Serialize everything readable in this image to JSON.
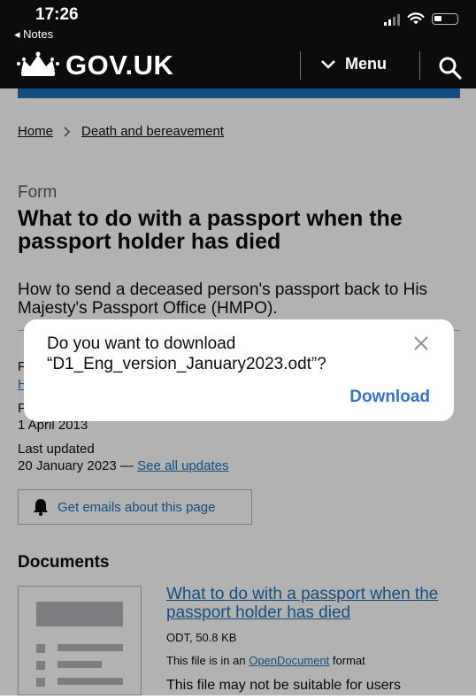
{
  "status_bar": {
    "time": "17:26",
    "back_app": "◂ Notes"
  },
  "header": {
    "logo_text": "GOV.UK",
    "menu_label": "Menu"
  },
  "breadcrumb": {
    "items": [
      "Home",
      "Death and bereavement"
    ]
  },
  "page": {
    "caption": "Form",
    "title": "What to do with a passport when the passport holder has died",
    "lead": "How to send a deceased person's passport back to His Majesty's Passport Office (HMPO).",
    "meta_from_label": "F",
    "meta_from_value": "H",
    "meta_published_label": "F",
    "published_date": "1 April 2013",
    "last_updated_label": "Last updated",
    "last_updated_date": "20 January 2023 —",
    "see_all_updates": "See all updates",
    "emails_button": "Get emails about this page",
    "documents_heading": "Documents"
  },
  "attachment": {
    "title": "What to do with a passport when the passport holder has died",
    "meta": "ODT, 50.8 KB",
    "format_prefix": "This file is in an",
    "format_link": "OpenDocument",
    "format_suffix": "format",
    "warning": "This file may not be suitable for users"
  },
  "dialog": {
    "message": "Do you want to download “D1_Eng_version_January2023.odt”?",
    "download_label": "Download"
  }
}
